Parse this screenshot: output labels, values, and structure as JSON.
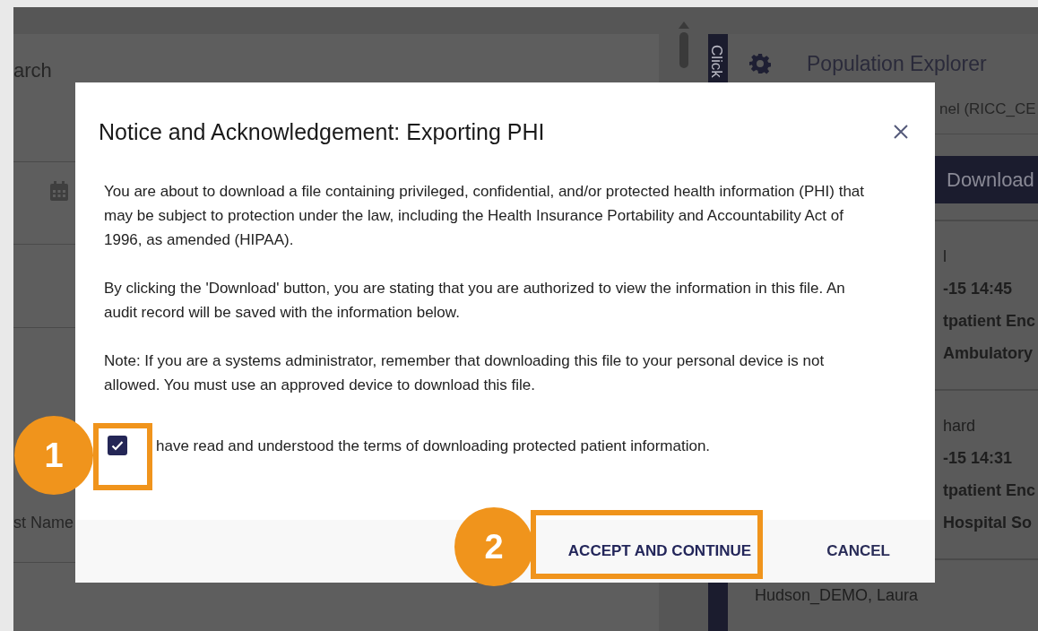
{
  "background": {
    "left_panel": {
      "title": "arch",
      "field_label": "st Name"
    },
    "right_panel": {
      "tab_label": "Click",
      "title": "Population Explorer",
      "subtitle": "nel (RICC_CE",
      "download_button": "Download",
      "cards": [
        {
          "lines": [
            "l",
            "-15 14:45",
            "tpatient Enc",
            "Ambulatory"
          ]
        },
        {
          "lines": [
            "hard",
            "-15 14:31",
            "tpatient Enc",
            "Hospital So"
          ]
        },
        {
          "lines": [
            "Hudson_DEMO, Laura"
          ]
        }
      ]
    }
  },
  "dialog": {
    "title": "Notice and Acknowledgement: Exporting PHI",
    "paragraphs": [
      "You are about to download a file containing privileged, confidential, and/or protected health information (PHI) that may be subject to protection under the law, including the Health Insurance Portability and Accountability Act of 1996, as amended (HIPAA).",
      "By clicking the 'Download' button, you are stating that you are authorized to view the information in this file. An audit record will be saved with the information below.",
      "Note: If you are a systems administrator, remember that downloading this file to your personal device is not allowed. You must use an approved device to download this file."
    ],
    "acknowledge": {
      "label": "have read and understood the terms of downloading protected patient information.",
      "checked": true
    },
    "buttons": [
      {
        "label": "ACCEPT AND CONTINUE",
        "kind": "primary"
      },
      {
        "label": "CANCEL",
        "kind": "secondary"
      }
    ]
  },
  "callouts": [
    {
      "number": "1"
    },
    {
      "number": "2"
    }
  ]
}
